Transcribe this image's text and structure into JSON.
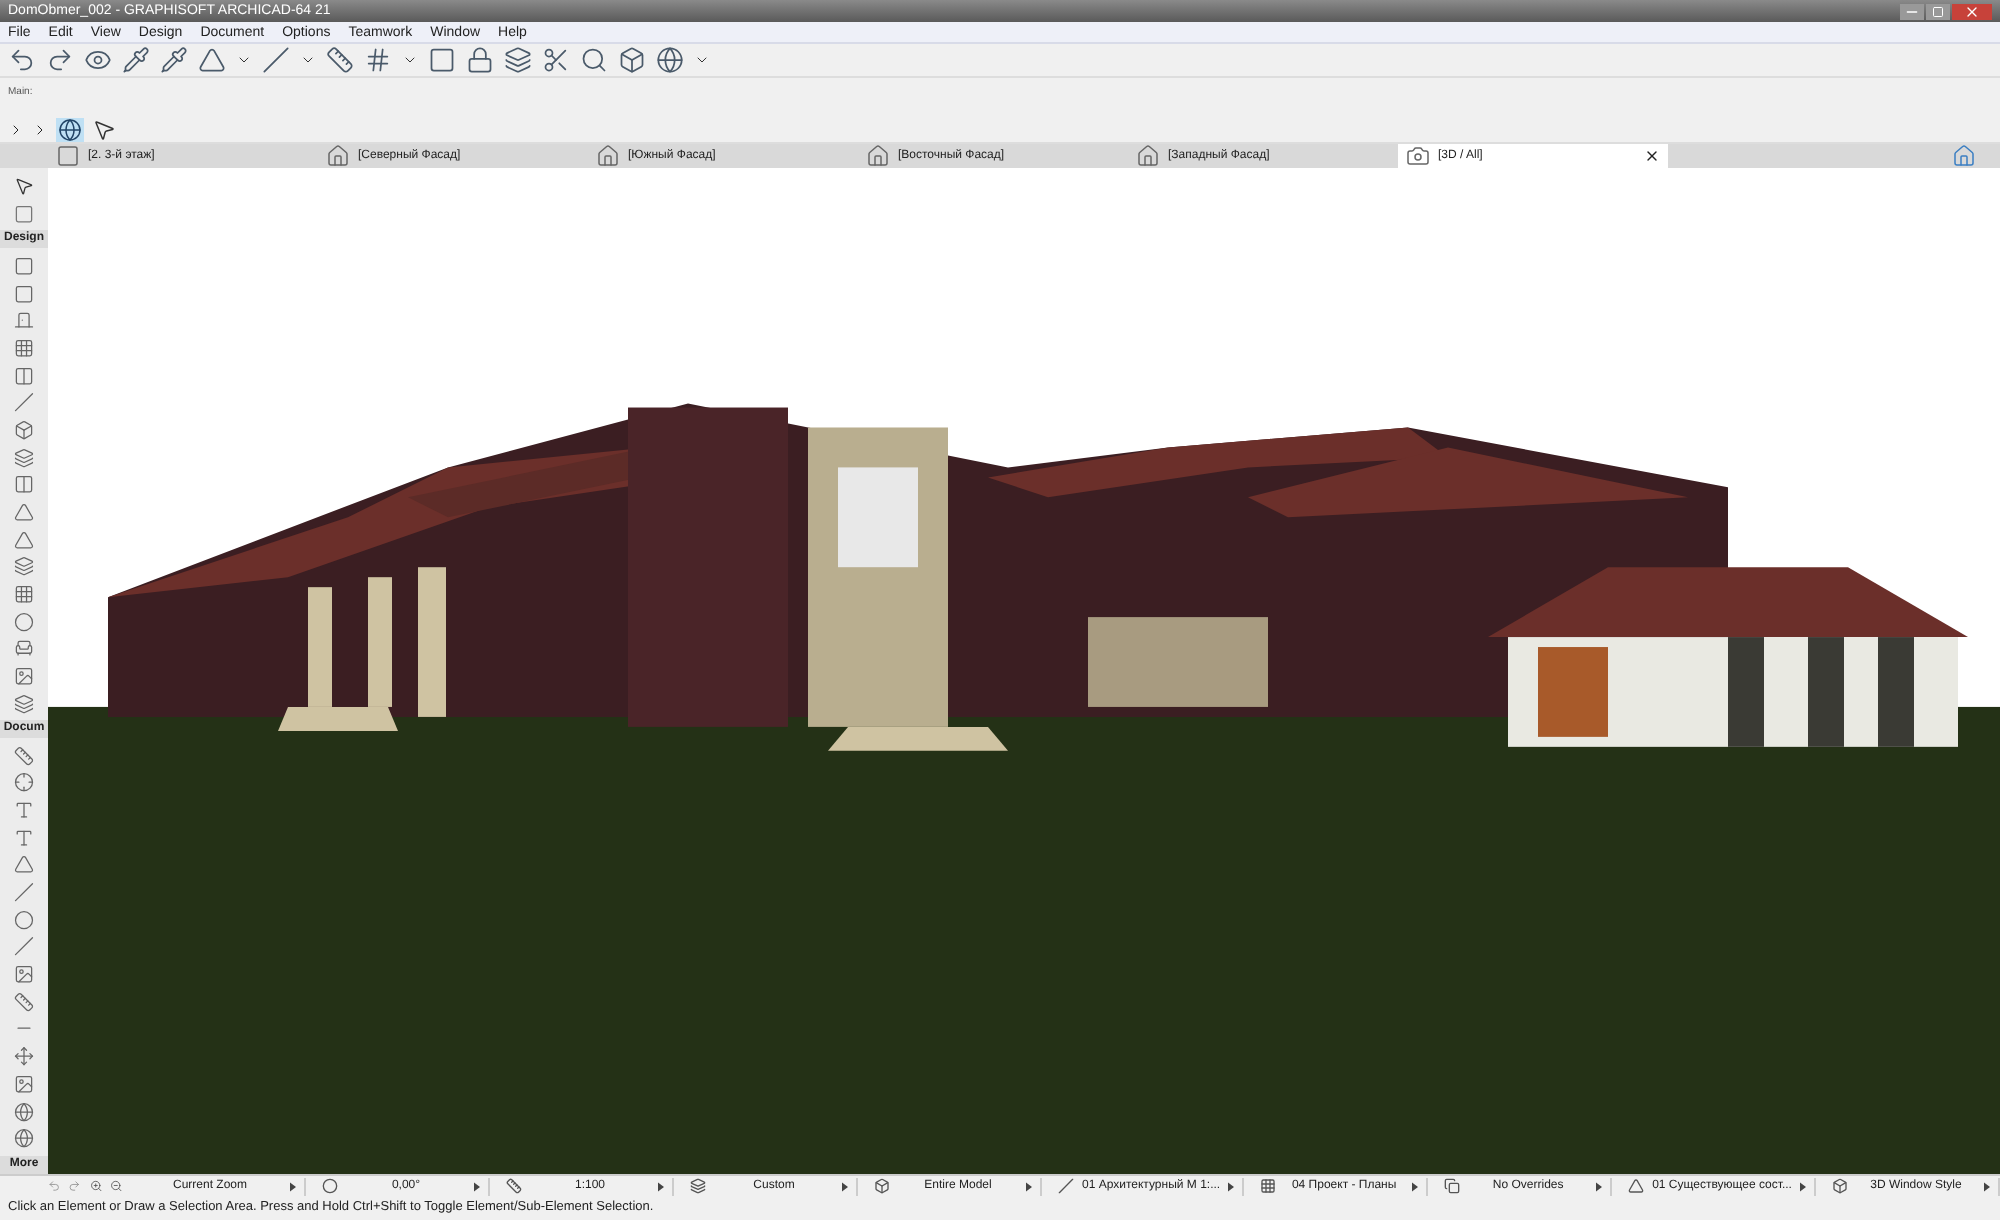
{
  "window": {
    "title": "DomObmer_002 - GRAPHISOFT ARCHICAD-64 21"
  },
  "menu": [
    "File",
    "Edit",
    "View",
    "Design",
    "Document",
    "Options",
    "Teamwork",
    "Window",
    "Help"
  ],
  "toolbar": {
    "label": "Main:"
  },
  "tabs": [
    {
      "label": "[2. 3-й этаж]",
      "kind": "plan",
      "selected": false
    },
    {
      "label": "[Северный Фасад]",
      "kind": "elevation",
      "selected": false
    },
    {
      "label": "[Южный Фасад]",
      "kind": "elevation",
      "selected": false
    },
    {
      "label": "[Восточный Фасад]",
      "kind": "elevation",
      "selected": false
    },
    {
      "label": "[Западный Фасад]",
      "kind": "elevation",
      "selected": false
    },
    {
      "label": "[3D / All]",
      "kind": "perspective",
      "selected": true
    }
  ],
  "toolbox": {
    "sections": [
      "Design",
      "Docum",
      "More"
    ]
  },
  "status_bar": {
    "items": [
      {
        "label": "Current Zoom",
        "kind": "zoom"
      },
      {
        "label": "0,00°",
        "kind": "angle"
      },
      {
        "label": "1:100",
        "kind": "scale"
      },
      {
        "label": "Custom",
        "kind": "layers"
      },
      {
        "label": "Entire Model",
        "kind": "model"
      },
      {
        "label": "01 Архитектурный М 1:...",
        "kind": "pen"
      },
      {
        "label": "04 Проект - Планы",
        "kind": "display"
      },
      {
        "label": "No Overrides",
        "kind": "override"
      },
      {
        "label": "01 Существующее сост...",
        "kind": "renovation"
      },
      {
        "label": "3D Window Style",
        "kind": "style"
      }
    ],
    "message": "Click an Element or Draw a Selection Area. Press and Hold Ctrl+Shift to Toggle Element/Sub-Element Selection."
  }
}
